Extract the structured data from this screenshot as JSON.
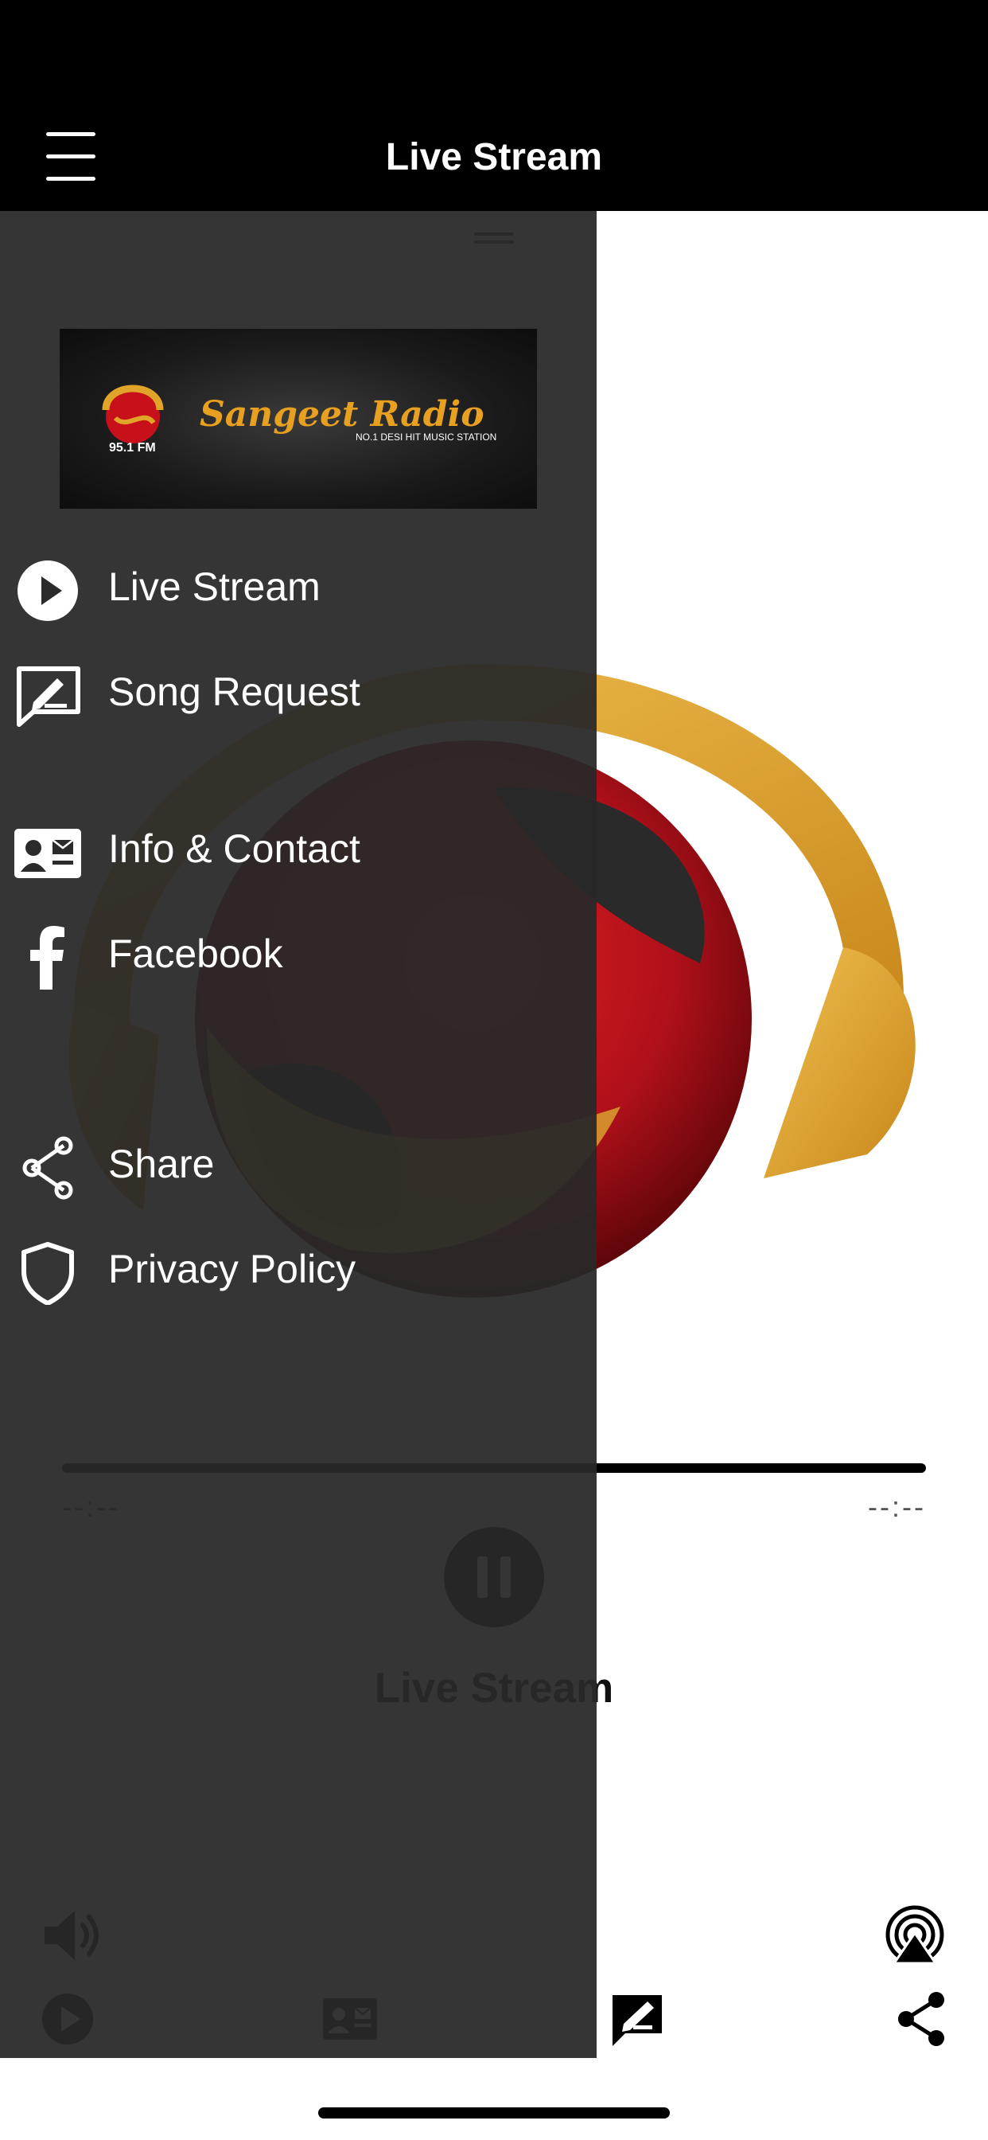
{
  "nav": {
    "title": "Live Stream"
  },
  "drawer": {
    "logo": {
      "brand": "Sangeet Radio",
      "tagline": "NO.1 DESI HIT MUSIC STATION",
      "frequency": "95.1 FM"
    },
    "items": [
      {
        "label": "Live Stream",
        "icon": "play-circle-icon"
      },
      {
        "label": "Song Request",
        "icon": "song-request-icon"
      },
      {
        "label": "Info & Contact",
        "icon": "contact-card-icon"
      },
      {
        "label": "Facebook",
        "icon": "facebook-icon"
      },
      {
        "label": "Share",
        "icon": "share-icon"
      },
      {
        "label": "Privacy Policy",
        "icon": "shield-icon"
      }
    ]
  },
  "player": {
    "elapsed": "--:--",
    "remaining": "--:--",
    "progress": 0,
    "title": "Live Stream",
    "state": "playing"
  },
  "tabbar": {
    "tabs": [
      {
        "name": "live-stream",
        "icon": "play-circle-icon"
      },
      {
        "name": "info-contact",
        "icon": "contact-card-icon"
      },
      {
        "name": "song-request",
        "icon": "song-request-icon"
      },
      {
        "name": "share",
        "icon": "share-icon"
      }
    ]
  },
  "colors": {
    "bar": "#000000",
    "drawer_overlay": "#2b2b2b",
    "accent_gold": "#e0a528",
    "accent_red": "#c8101a",
    "text_on_dark": "#ffffff"
  }
}
